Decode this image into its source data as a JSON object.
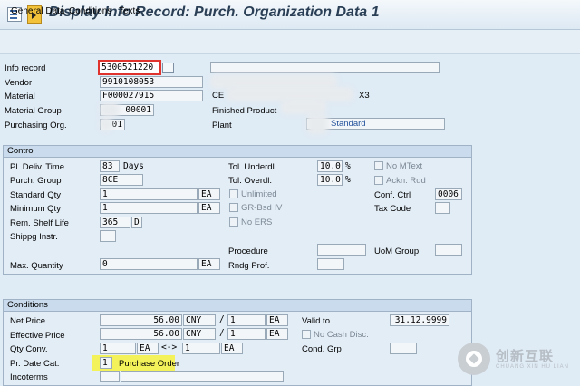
{
  "title": "Display Info Record: Purch. Organization Data 1",
  "toolbar": {
    "general": "General Data",
    "conditions": "Conditions",
    "texts": "Texts"
  },
  "header": {
    "info_record_label": "Info record",
    "info_record": "5300521220",
    "vendor_label": "Vendor",
    "vendor": "9910108053",
    "material_label": "Material",
    "material": "F000027915",
    "material_desc_partial": "CE",
    "material_desc_end": "X3",
    "material_group_label": "Material Group",
    "material_group": "00001",
    "material_group_desc": "Finished Product",
    "purch_org_label": "Purchasing Org.",
    "purch_org": "01",
    "plant_label": "Plant",
    "plant_desc": "Standard"
  },
  "control": {
    "heading": "Control",
    "pl_deliv_time_label": "Pl. Deliv. Time",
    "pl_deliv_time": "83",
    "pl_deliv_unit": "Days",
    "purch_group_label": "Purch. Group",
    "purch_group": "8CE",
    "standard_qty_label": "Standard Qty",
    "standard_qty": "1",
    "standard_qty_unit": "EA",
    "minimum_qty_label": "Minimum Qty",
    "minimum_qty": "1",
    "minimum_qty_unit": "EA",
    "rem_shelf_life_label": "Rem. Shelf Life",
    "rem_shelf_life": "365",
    "rem_shelf_life_unit": "D",
    "shippg_instr_label": "Shippg Instr.",
    "max_quantity_label": "Max. Quantity",
    "max_quantity": "0",
    "max_quantity_unit": "EA",
    "tol_underdl_label": "Tol. Underdl.",
    "tol_underdl": "10.0",
    "tol_underdl_unit": "%",
    "tol_overdl_label": "Tol. Overdl.",
    "tol_overdl": "10.0",
    "tol_overdl_unit": "%",
    "unlimited_label": "Unlimited",
    "gr_bsd_iv_label": "GR-Bsd IV",
    "no_ers_label": "No ERS",
    "procedure_label": "Procedure",
    "rndg_prof_label": "Rndg Prof.",
    "no_mtext_label": "No MText",
    "ackn_rqd_label": "Ackn. Rqd",
    "conf_ctrl_label": "Conf. Ctrl",
    "conf_ctrl": "0006",
    "tax_code_label": "Tax Code",
    "uom_group_label": "UoM Group"
  },
  "conditions": {
    "heading": "Conditions",
    "net_price_label": "Net Price",
    "net_price": "56.00",
    "net_price_currency": "CNY",
    "net_price_per": "1",
    "net_price_unit": "EA",
    "eff_price_label": "Effective Price",
    "eff_price": "56.00",
    "eff_price_currency": "CNY",
    "eff_price_per": "1",
    "eff_price_unit": "EA",
    "valid_to_label": "Valid to",
    "valid_to": "31.12.9999",
    "no_cash_disc_label": "No Cash Disc.",
    "qty_conv_label": "Qty Conv.",
    "qty_conv_left": "1",
    "qty_conv_left_unit": "EA",
    "qty_conv_arrow": "<->",
    "qty_conv_right": "1",
    "qty_conv_right_unit": "EA",
    "cond_grp_label": "Cond. Grp",
    "pr_date_cat_label": "Pr. Date Cat.",
    "pr_date_cat": "1",
    "pr_date_cat_desc": "Purchase Order",
    "incoterms_label": "Incoterms"
  },
  "watermark": {
    "text": "创新互联",
    "sub": "CHUANG XIN HU LIAN"
  }
}
